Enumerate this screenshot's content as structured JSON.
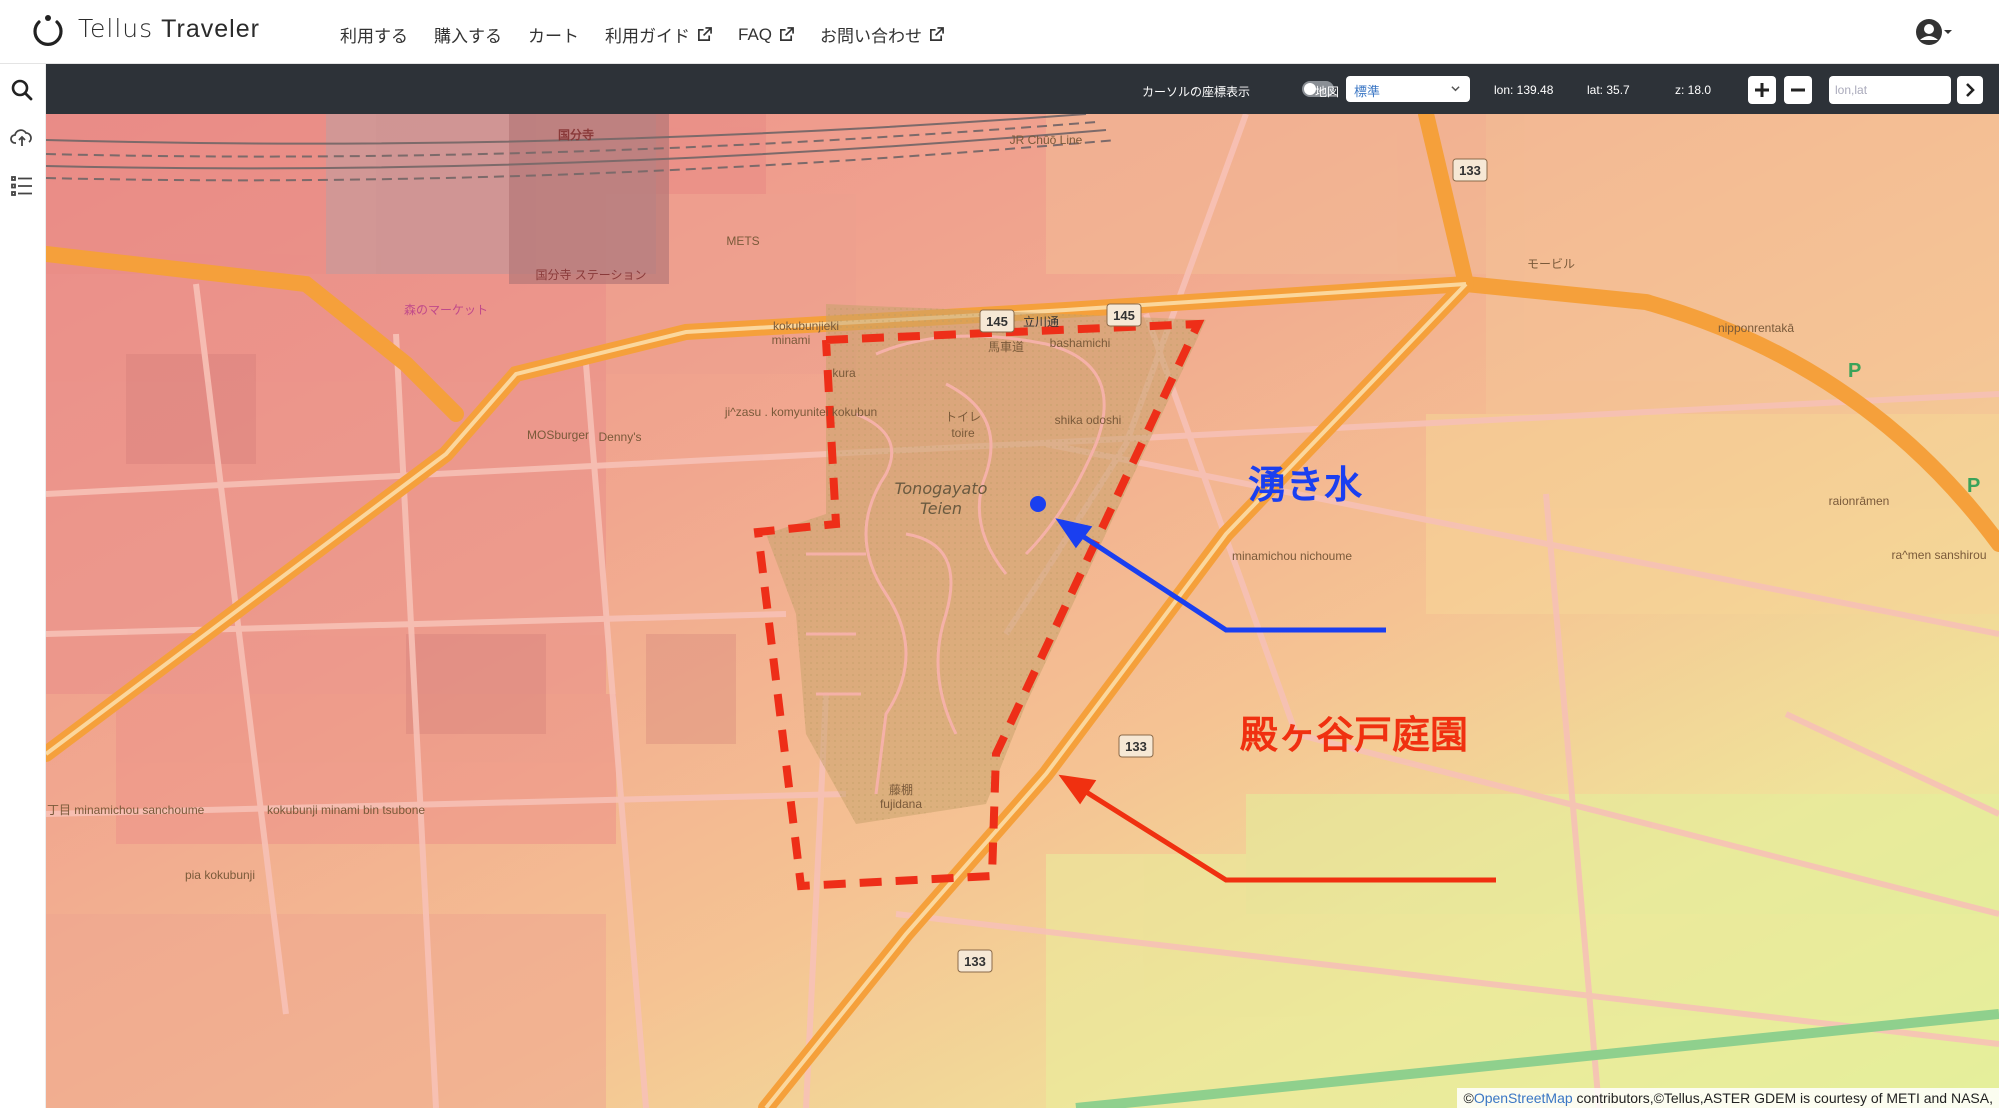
{
  "header": {
    "brand_part1": "Tellus",
    "brand_part2": "Traveler",
    "nav": [
      {
        "label": "利用する"
      },
      {
        "label": "購入する"
      },
      {
        "label": "カート"
      },
      {
        "label": "利用ガイド"
      },
      {
        "label": "FAQ"
      },
      {
        "label": "お問い合わせ"
      }
    ],
    "account_icon": "user-circle-icon"
  },
  "sidebar": {
    "icons": [
      "search-icon",
      "cloud-upload-icon",
      "list-icon"
    ]
  },
  "toolbar": {
    "cursor_coord_label": "カーソルの座標表示",
    "map_label": "地図",
    "map_select_value": "標準",
    "lon": "lon: 139.48",
    "lat": "lat: 35.7",
    "zoom": "z: 18.0",
    "coord_placeholder": "lon,lat",
    "zoom_in_icon": "plus-icon",
    "zoom_out_icon": "minus-icon",
    "go_icon": "chevron-right-icon"
  },
  "map": {
    "park_name_line1": "Tonogayato",
    "park_name_line2": "Teien",
    "road_labels": [
      "133",
      "133",
      "133",
      "145",
      "145"
    ],
    "place_labels": {
      "kokubunji_station": "国分寺",
      "kokubunjieki": "kokubunjieki",
      "minami": "minami",
      "bashamichi_jp": "馬車道",
      "bashamichi": "bashamichi",
      "shika_odoshi": "shika odoshi",
      "toire_jp": "トイレ",
      "toire": "toire",
      "fujidana_jp": "藤棚",
      "fujidana": "fujidana",
      "mets": "METS",
      "mosburger": "MOSburger",
      "dennys": "Denny's",
      "komyunitei": "ji^zasu . komyunitei kokubun",
      "mobil": "モービル",
      "nipponrentaka": "nipponrentakā",
      "minamichou": "minamichou nichoume",
      "kokubunji_post": "kokubunji minami bin tsubone",
      "pia": "pia kokubunji",
      "minamichou_sanchome": "南町三 丁目 minamichou sanchoume",
      "raionramen": "raionrāmen",
      "sanshirou": "ra^men sanshirou",
      "jr": "JR Chūō Line",
      "kura": "kura",
      "tanda": "立川通",
      "morino": "森のマーケット",
      "kokubunji_ekibiru": "国分寺 ステーション"
    },
    "parking_labels": [
      "P",
      "P"
    ]
  },
  "annotations": {
    "spring": "湧き水",
    "garden": "殿ヶ谷戸庭園",
    "spring_color": "#1a3ff0",
    "garden_color": "#f03010"
  },
  "attribution": {
    "prefix": "©",
    "link": "OpenStreetMap",
    "suffix": " contributors,©Tellus,ASTER GDEM is courtesy of METI and NASA,"
  }
}
